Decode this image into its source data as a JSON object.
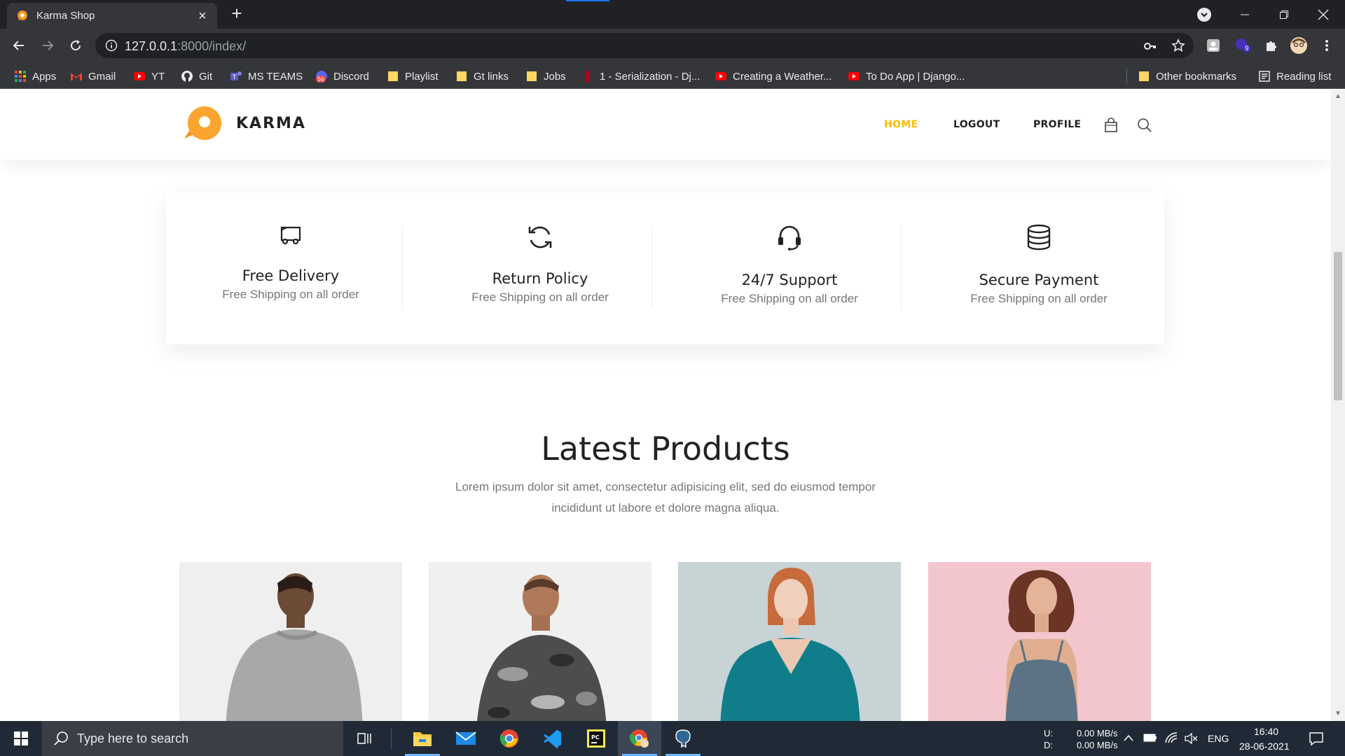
{
  "browser": {
    "tab_title": "Karma Shop",
    "url_host": "127.0.0.1",
    "url_path": ":8000/index/",
    "bookmarks": [
      {
        "label": "Apps",
        "icon": "apps-grid-icon"
      },
      {
        "label": "Gmail",
        "icon": "gmail-icon"
      },
      {
        "label": "YT",
        "icon": "youtube-icon"
      },
      {
        "label": "Git",
        "icon": "github-icon"
      },
      {
        "label": "MS TEAMS",
        "icon": "teams-icon"
      },
      {
        "label": "Discord",
        "icon": "discord-icon",
        "badge": "56"
      },
      {
        "label": "Playlist",
        "icon": "folder-icon"
      },
      {
        "label": "Gt links",
        "icon": "folder-icon"
      },
      {
        "label": "Jobs",
        "icon": "folder-icon"
      },
      {
        "label": "1 - Serialization - Dj...",
        "icon": "bookmark-red-icon"
      },
      {
        "label": "Creating a Weather...",
        "icon": "youtube-icon"
      },
      {
        "label": "To Do App | Django...",
        "icon": "youtube-icon"
      }
    ],
    "other_bookmarks": "Other bookmarks",
    "reading_list": "Reading list",
    "extension_badge": "9"
  },
  "site": {
    "brand": "KARMA",
    "nav": [
      {
        "label": "HOME",
        "active": true
      },
      {
        "label": "LOGOUT",
        "active": false
      },
      {
        "label": "PROFILE",
        "active": false
      }
    ],
    "accent_color": "#ffba00",
    "features": [
      {
        "title": "Free Delivery",
        "subtitle": "Free Shipping on all order",
        "icon": "truck-icon"
      },
      {
        "title": "Return Policy",
        "subtitle": "Free Shipping on all order",
        "icon": "refresh-icon"
      },
      {
        "title": "24/7 Support",
        "subtitle": "Free Shipping on all order",
        "icon": "headset-icon"
      },
      {
        "title": "Secure Payment",
        "subtitle": "Free Shipping on all order",
        "icon": "database-icon"
      }
    ],
    "section_title": "Latest Products",
    "section_desc": "Lorem ipsum dolor sit amet, consectetur adipisicing elit, sed do eiusmod tempor incididunt ut labore et dolore magna aliqua.",
    "products": [
      {
        "name": "man-grey-sweatshirt",
        "bg": "#ececec"
      },
      {
        "name": "man-camo-shirt",
        "bg": "#eeeeee"
      },
      {
        "name": "woman-teal-top",
        "bg": "#c4cfd1"
      },
      {
        "name": "woman-grey-tank",
        "bg": "#f2c5cb"
      }
    ]
  },
  "taskbar": {
    "search_placeholder": "Type here to search",
    "net_upload_label": "U:",
    "net_download_label": "D:",
    "net_upload": "0.00 MB/s",
    "net_download": "0.00 MB/s",
    "language": "ENG",
    "time": "16:40",
    "date": "28-06-2021"
  }
}
